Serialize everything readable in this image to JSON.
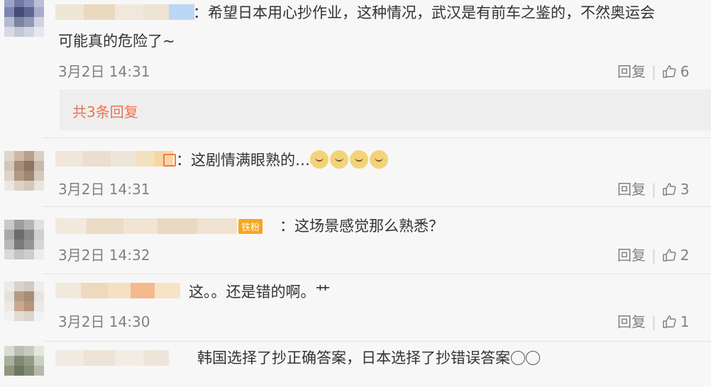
{
  "comments": [
    {
      "text_line1": "：希望日本用心抄作业，这种情况，武汉是有前车之鉴的，不然奥运会",
      "text_line2": "可能真的危险了~",
      "time": "3月2日 14:31",
      "reply_label": "回复",
      "likes": "6"
    },
    {
      "text": "：这剧情满眼熟的…",
      "time": "3月2日 14:31",
      "reply_label": "回复",
      "likes": "3"
    },
    {
      "badge": "铁粉",
      "text": "：这场景感觉那么熟悉？",
      "time": "3月2日 14:32",
      "reply_label": "回复",
      "likes": "2"
    },
    {
      "text": "这。。还是错的啊。艹",
      "time": "3月2日 14:30",
      "reply_label": "回复",
      "likes": "1"
    },
    {
      "text": "韩国选择了抄正确答案，日本选择了抄错误答案"
    }
  ],
  "replies_summary": "共3条回复",
  "colors": {
    "accent": "#eb7350",
    "muted": "#808080",
    "background": "#f7f7f7"
  }
}
